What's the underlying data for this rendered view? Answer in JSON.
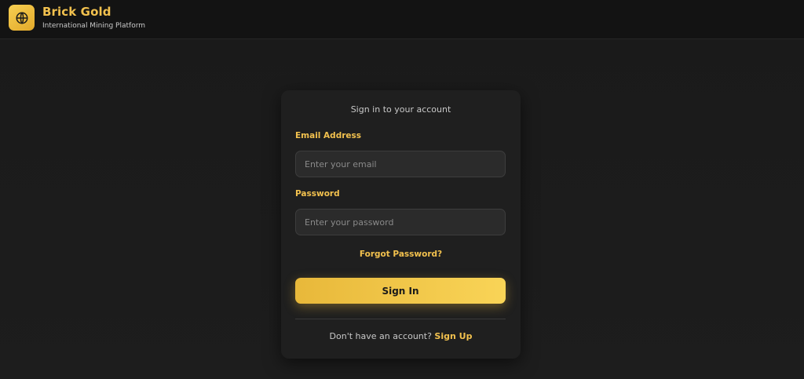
{
  "header": {
    "brand_name": "Brick Gold",
    "brand_tagline": "International Mining Platform",
    "logo_icon": "globe-icon"
  },
  "login": {
    "heading": "Sign in to your account",
    "email_label": "Email Address",
    "email_placeholder": "Enter your email",
    "email_value": "",
    "password_label": "Password",
    "password_placeholder": "Enter your password",
    "password_value": "",
    "forgot_link": "Forgot Password?",
    "submit_label": "Sign In",
    "signup_prompt": "Don't have an account?",
    "signup_link": "Sign Up"
  },
  "colors": {
    "accent": "#f2c14e",
    "background": "#1b1b1b",
    "card": "#1f1f1f"
  }
}
